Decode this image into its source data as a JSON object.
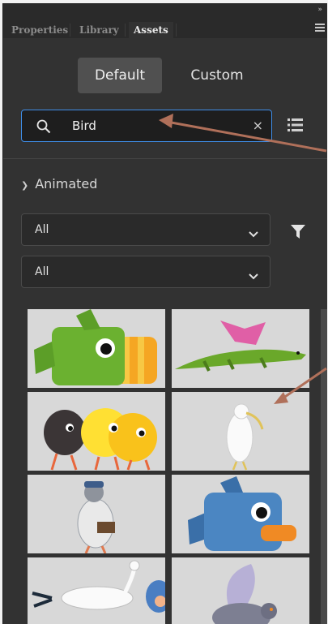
{
  "tabs": [
    {
      "label": "Properties",
      "active": false
    },
    {
      "label": "Library",
      "active": false
    },
    {
      "label": "Assets",
      "active": true
    }
  ],
  "panel": {
    "collapse_glyph": "»"
  },
  "segment": {
    "default_label": "Default",
    "custom_label": "Custom",
    "selected": "Default"
  },
  "search": {
    "value": "Bird",
    "clear_glyph": "×",
    "icon": "search-icon"
  },
  "view_toggle_icon": "list-view-icon",
  "section": {
    "label": "Animated",
    "expanded": true
  },
  "filters": {
    "first": "All",
    "second": "All"
  },
  "filter_icon": "funnel-icon",
  "assets": [
    {
      "name": "green-toucan"
    },
    {
      "name": "winged-crocodile"
    },
    {
      "name": "chicks-group"
    },
    {
      "name": "white-ibis"
    },
    {
      "name": "pigeon-mail-carrier"
    },
    {
      "name": "blue-duck"
    },
    {
      "name": "stork-with-baby"
    },
    {
      "name": "flying-pigeon"
    }
  ],
  "colors": {
    "accent": "#3f8ee9",
    "panel": "#323232",
    "annotation_arrow": "#b0705a"
  }
}
